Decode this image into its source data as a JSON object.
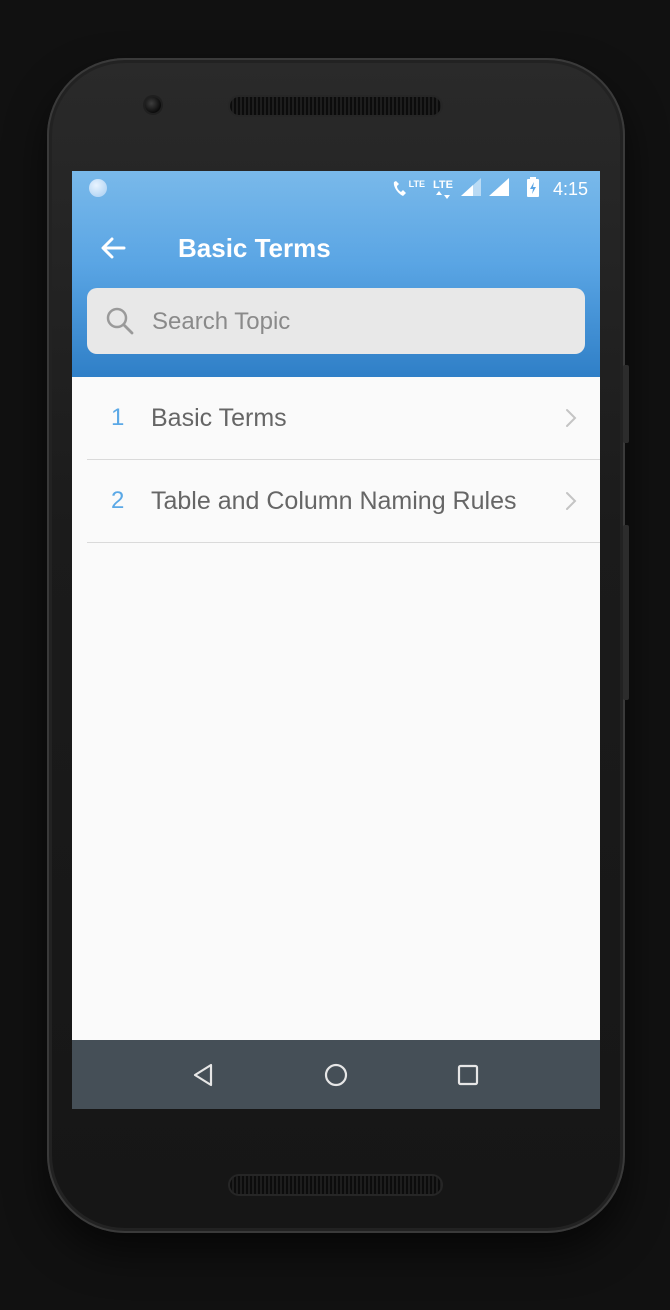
{
  "status_bar": {
    "call_badge": "LTE",
    "data_badge": "LTE",
    "time": "4:15"
  },
  "app_bar": {
    "back_icon": "arrow-left-icon",
    "title": "Basic Terms"
  },
  "search": {
    "icon": "search-icon",
    "placeholder": "Search Topic",
    "value": ""
  },
  "topics": [
    {
      "number": "1",
      "label": "Basic Terms"
    },
    {
      "number": "2",
      "label": "Table and Column Naming Rules"
    }
  ],
  "nav_bar": {
    "back": "triangle-back-icon",
    "home": "circle-home-icon",
    "recents": "square-recents-icon"
  },
  "colors": {
    "header_top": "#79b9ea",
    "header_bottom": "#2f7fc7",
    "accent_number": "#5aa8e6",
    "nav_bar": "#454f57"
  }
}
